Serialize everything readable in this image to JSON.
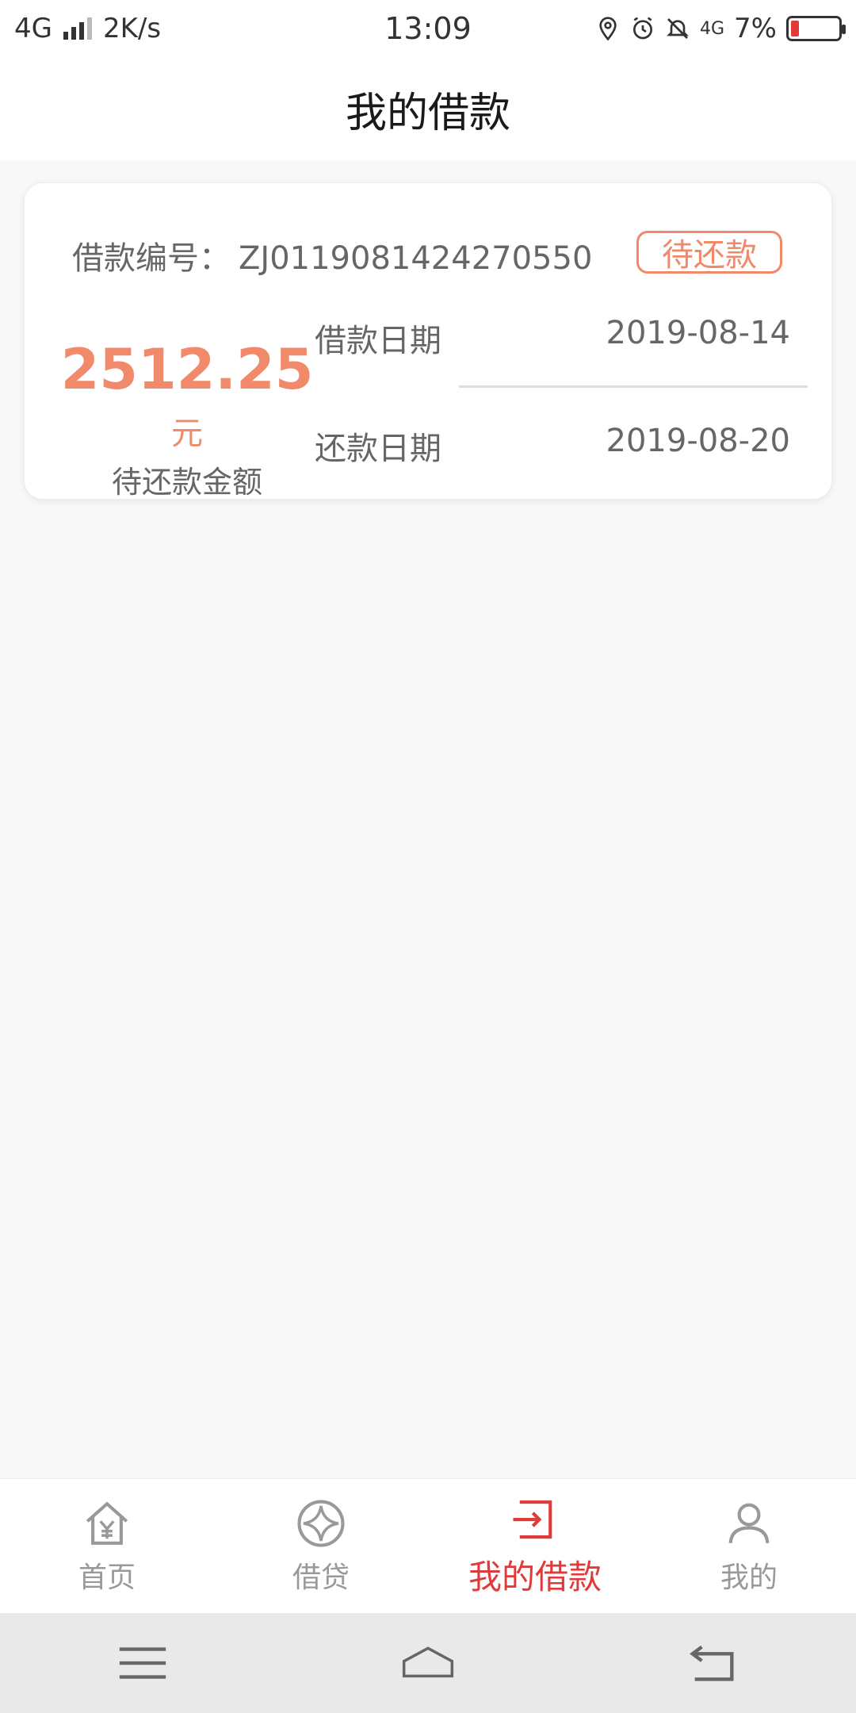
{
  "status_bar": {
    "network": "4G",
    "speed": "2K/s",
    "time": "13:09",
    "mini_network": "4G",
    "battery": "7%",
    "battery_level": 0.07
  },
  "header": {
    "title": "我的借款"
  },
  "loan": {
    "number_label": "借款编号：",
    "number": "ZJ0119081424270550",
    "status": "待还款",
    "amount": "2512.25",
    "amount_unit": "元",
    "amount_label": "待还款金额",
    "loan_date_label": "借款日期",
    "loan_date": "2019-08-14",
    "repay_date_label": "还款日期",
    "repay_date": "2019-08-20"
  },
  "bottom_nav": {
    "items": [
      {
        "label": "首页",
        "icon": "home-icon"
      },
      {
        "label": "借贷",
        "icon": "loan-icon"
      },
      {
        "label": "我的借款",
        "icon": "my-loan-icon"
      },
      {
        "label": "我的",
        "icon": "user-icon"
      }
    ]
  },
  "colors": {
    "accent": "#f08a6b",
    "active_nav": "#e03a3a"
  }
}
